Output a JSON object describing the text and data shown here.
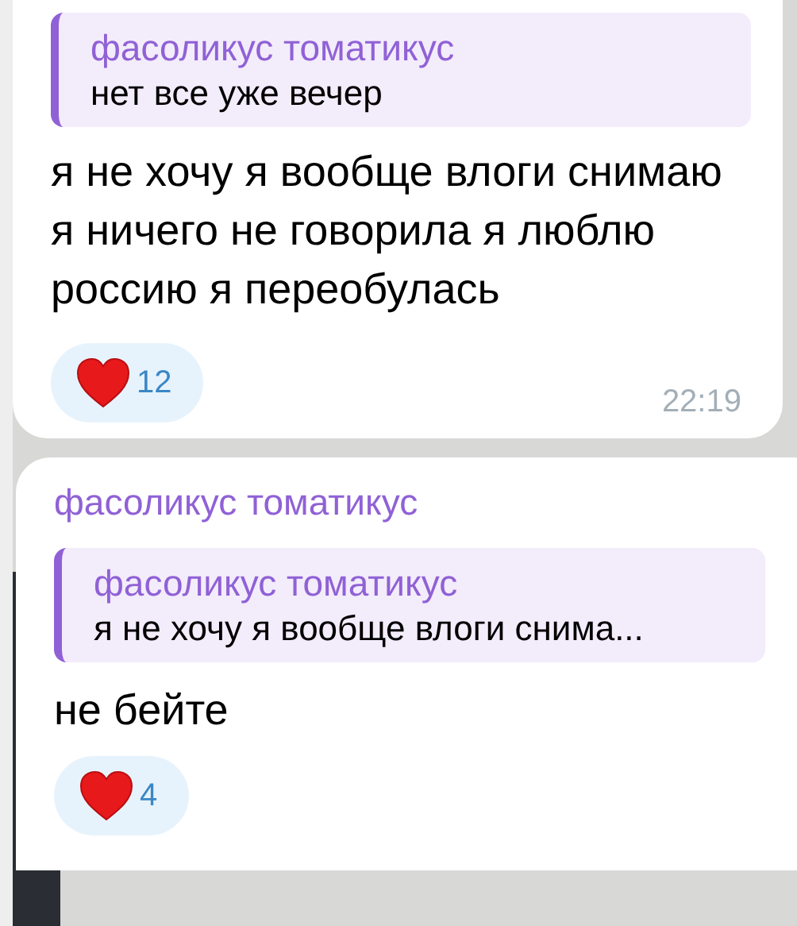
{
  "messages": [
    {
      "reply": {
        "author": "фасоликус томатикус",
        "text": "нет все уже вечер"
      },
      "text": "я не хочу я вообще влоги снимаю я ничего не говорила я люблю россию я переобулась",
      "reactions": [
        {
          "count": "12"
        }
      ],
      "time": "22:19"
    },
    {
      "author": "фасоликус томатикус",
      "reply": {
        "author": "фасоликус томатикус",
        "text": "я не хочу я вообще влоги снима..."
      },
      "text": "не бейте",
      "reactions": [
        {
          "count": "4"
        }
      ]
    }
  ]
}
